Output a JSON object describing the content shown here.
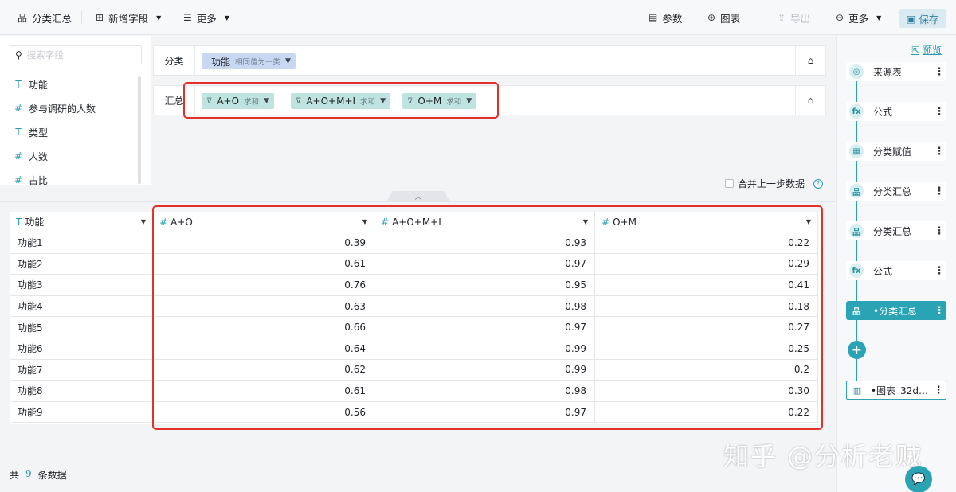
{
  "toolbar": {
    "title": "分类汇总",
    "add_field": "新增字段",
    "more_left": "更多",
    "params": "参数",
    "chart": "图表",
    "export": "导出",
    "more_right": "更多",
    "save": "保存"
  },
  "fields_panel": {
    "search_placeholder": "搜索字段",
    "items": [
      {
        "type": "text",
        "type_icon": "T",
        "label": "功能"
      },
      {
        "type": "number",
        "type_icon": "#",
        "label": "参与调研的人数"
      },
      {
        "type": "text",
        "type_icon": "T",
        "label": "类型"
      },
      {
        "type": "number",
        "type_icon": "#",
        "label": "人数"
      },
      {
        "type": "number",
        "type_icon": "#",
        "label": "占比"
      }
    ]
  },
  "config": {
    "group_label": "分类",
    "group_chip": {
      "name": "功能",
      "sub": "相同值为一类"
    },
    "sum_label": "汇总",
    "sum_chips": [
      {
        "name": "A+O",
        "sub": "求和"
      },
      {
        "name": "A+O+M+I",
        "sub": "求和"
      },
      {
        "name": "O+M",
        "sub": "求和"
      }
    ],
    "merge_label": "合并上一步数据",
    "help_glyph": "?"
  },
  "table": {
    "columns": [
      {
        "type_icon": "T",
        "label": "功能"
      },
      {
        "type_icon": "#",
        "label": "A+O"
      },
      {
        "type_icon": "#",
        "label": "A+O+M+I"
      },
      {
        "type_icon": "#",
        "label": "O+M"
      }
    ],
    "rows": [
      [
        "功能1",
        "0.39",
        "0.93",
        "0.22"
      ],
      [
        "功能2",
        "0.61",
        "0.97",
        "0.29"
      ],
      [
        "功能3",
        "0.76",
        "0.95",
        "0.41"
      ],
      [
        "功能4",
        "0.63",
        "0.98",
        "0.18"
      ],
      [
        "功能5",
        "0.66",
        "0.97",
        "0.27"
      ],
      [
        "功能6",
        "0.64",
        "0.99",
        "0.25"
      ],
      [
        "功能7",
        "0.62",
        "0.99",
        "0.2"
      ],
      [
        "功能8",
        "0.61",
        "0.98",
        "0.30"
      ],
      [
        "功能9",
        "0.56",
        "0.97",
        "0.22"
      ]
    ]
  },
  "footer": {
    "prefix": "共",
    "count": "9",
    "suffix": "条数据"
  },
  "pipeline": {
    "preview": "预览",
    "steps": [
      {
        "label": "来源表",
        "icon": "source-icon",
        "glyph": "◎",
        "active": false
      },
      {
        "label": "公式",
        "icon": "formula-icon",
        "glyph": "fx",
        "active": false
      },
      {
        "label": "分类赋值",
        "icon": "assign-icon",
        "glyph": "▦",
        "active": false
      },
      {
        "label": "分类汇总",
        "icon": "group-icon",
        "glyph": "品",
        "active": false
      },
      {
        "label": "分类汇总",
        "icon": "group-icon",
        "glyph": "品",
        "active": false
      },
      {
        "label": "公式",
        "icon": "formula-icon",
        "glyph": "fx",
        "active": false
      },
      {
        "label": "•分类汇总",
        "icon": "group-icon",
        "glyph": "品",
        "active": true
      }
    ],
    "add_glyph": "+",
    "chart_step": "•图表_32d1..."
  },
  "watermark": "知乎 @分析老贼",
  "colors": {
    "accent": "#2aa3b4",
    "highlight_border": "#e0322a",
    "group_chip": "#c9d8f2",
    "sum_chip": "#bfe3df"
  }
}
